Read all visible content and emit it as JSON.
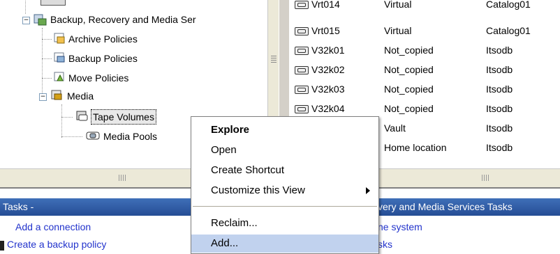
{
  "tree": {
    "root_label": "Backup, Recovery and Media Ser",
    "children": [
      {
        "label": "Archive Policies",
        "icon": "archive-policy-icon"
      },
      {
        "label": "Backup Policies",
        "icon": "backup-policy-icon"
      },
      {
        "label": "Move Policies",
        "icon": "move-policy-icon"
      },
      {
        "label": "Media",
        "icon": "media-icon"
      }
    ],
    "media_children": [
      {
        "label": "Tape Volumes",
        "icon": "tape-volume-icon"
      },
      {
        "label": "Media Pools",
        "icon": "media-pool-icon"
      }
    ]
  },
  "list": {
    "rows": [
      {
        "name": "Vrt014",
        "status": "Virtual",
        "db": "Catalog01"
      },
      {
        "name": "Vrt015",
        "status": "Virtual",
        "db": "Catalog01"
      },
      {
        "name": "V32k01",
        "status": "Not_copied",
        "db": "Itsodb"
      },
      {
        "name": "V32k02",
        "status": "Not_copied",
        "db": "Itsodb"
      },
      {
        "name": "V32k03",
        "status": "Not_copied",
        "db": "Itsodb"
      },
      {
        "name": "V32k04",
        "status": "Not_copied",
        "db": "Itsodb"
      },
      {
        "name": "",
        "status": "Vault",
        "db": "Itsodb"
      },
      {
        "name": "",
        "status": "Home location",
        "db": "Itsodb"
      }
    ]
  },
  "context_menu": {
    "items": [
      {
        "label": "Explore",
        "bold": true
      },
      {
        "label": "Open"
      },
      {
        "label": "Create Shortcut"
      },
      {
        "label": "Customize this View",
        "submenu": true
      },
      {
        "label": "Reclaim..."
      },
      {
        "label": "Add...",
        "highlighted": true
      }
    ]
  },
  "tasks_left": {
    "header": "Tasks -",
    "links": [
      "Add a connection",
      "Create a backup policy"
    ]
  },
  "tasks_right": {
    "header": "very and Media Services Tasks",
    "links": [
      "ne system",
      "sks"
    ]
  },
  "colors": {
    "task_header": "#2f5ea8",
    "link": "#2233cc",
    "menu_highlight": "#c1d2ee"
  }
}
